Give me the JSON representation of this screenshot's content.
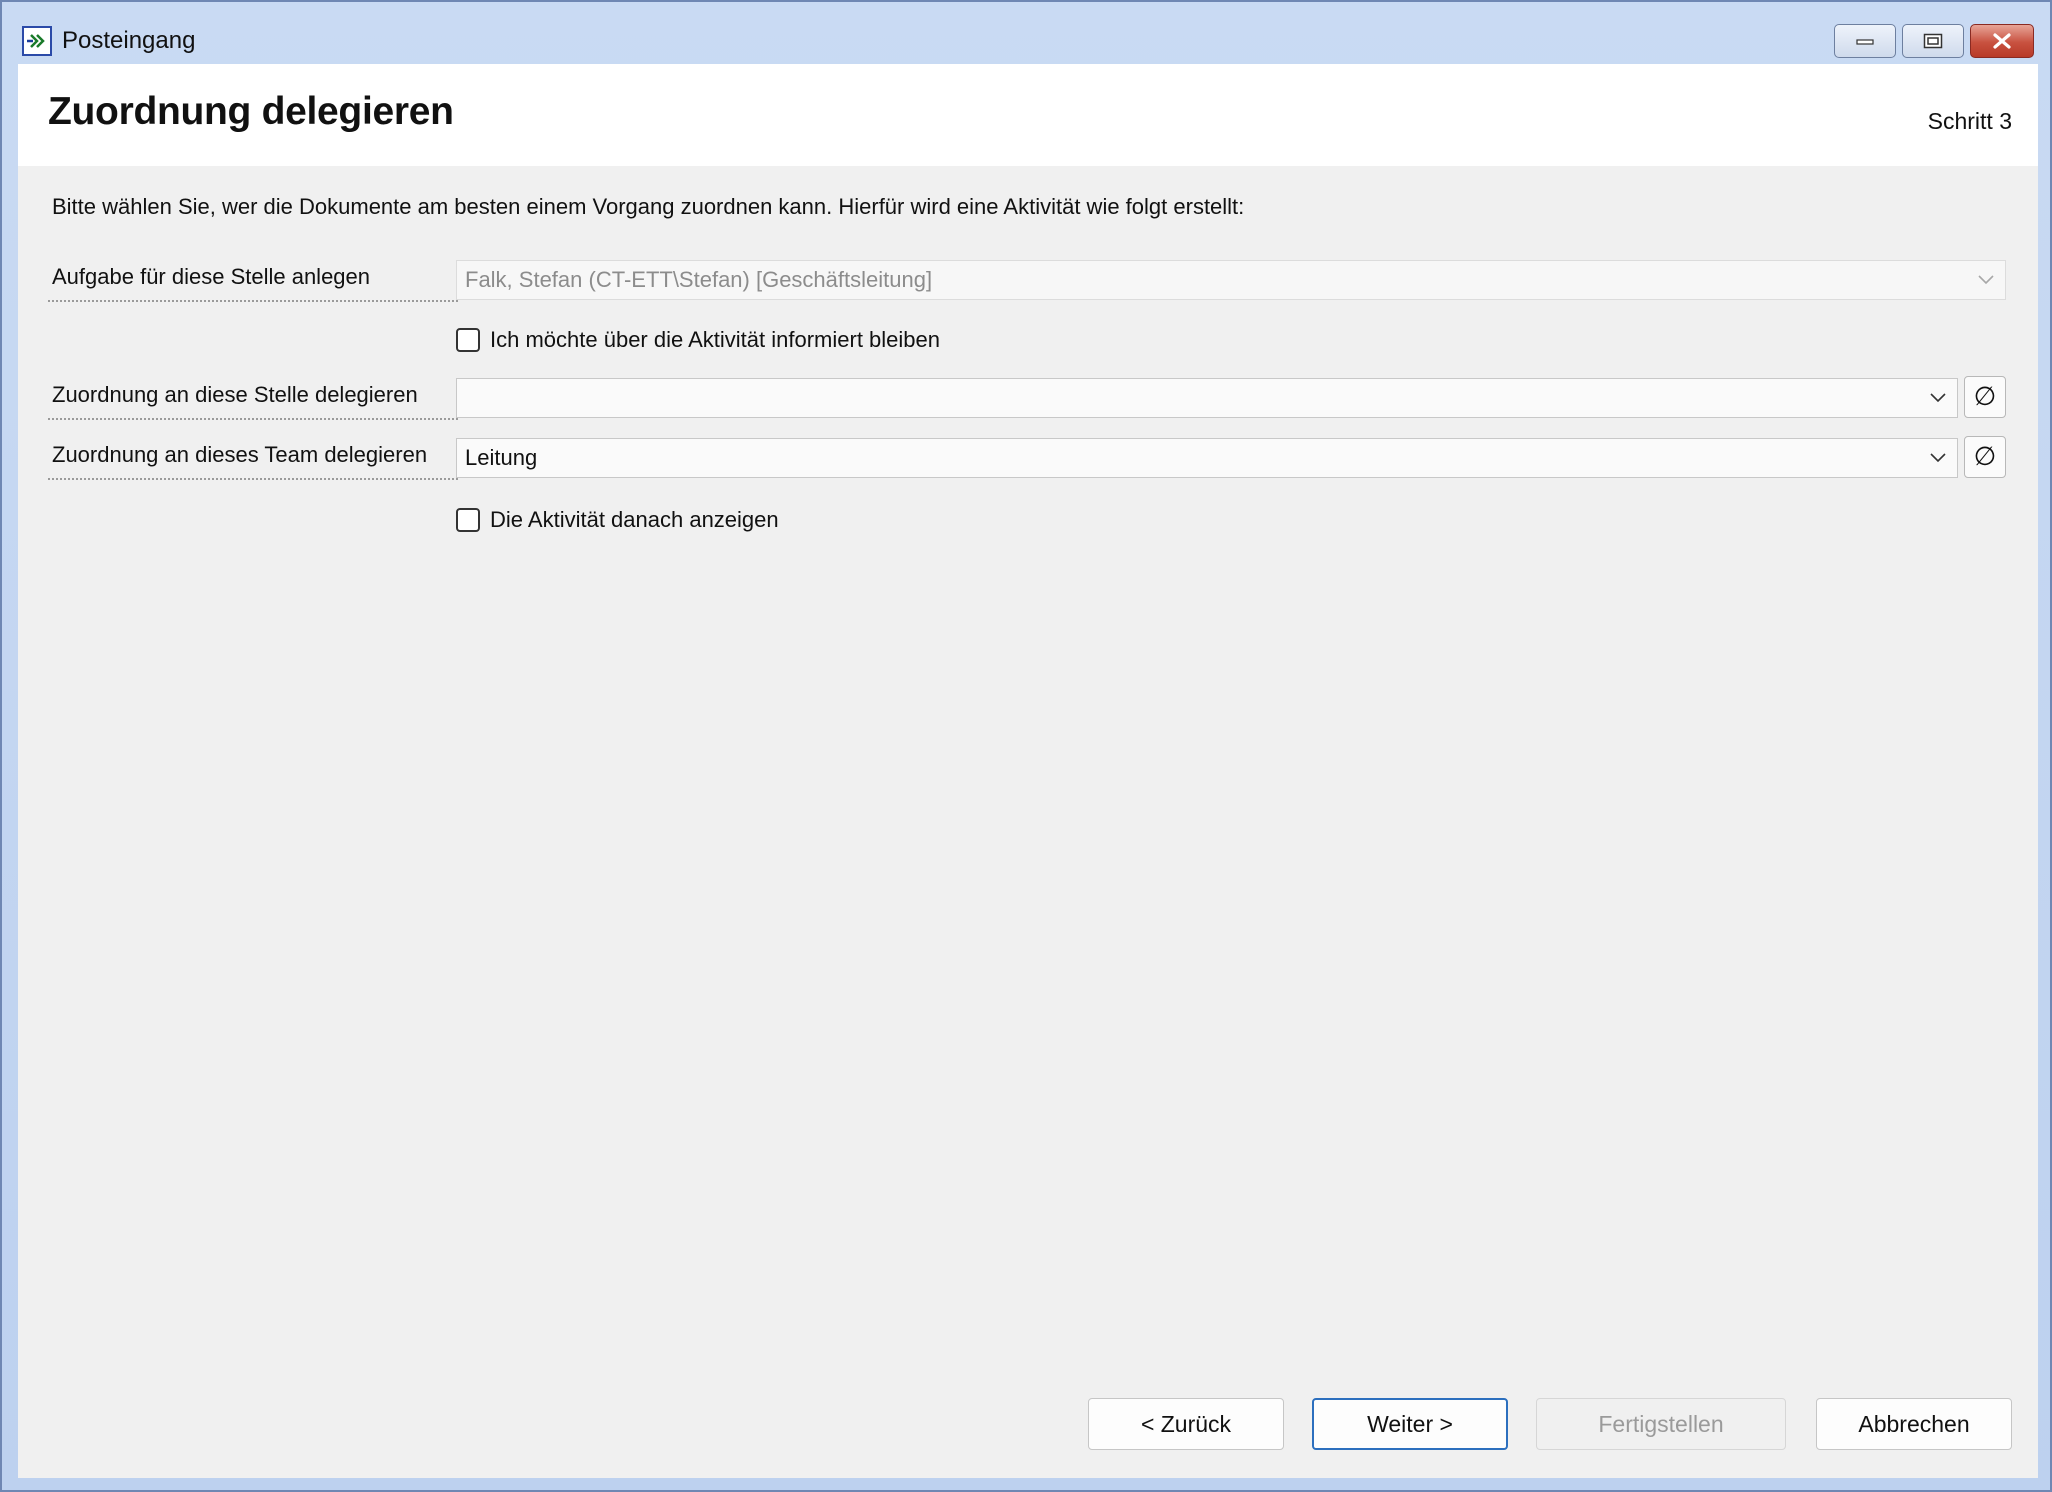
{
  "window": {
    "title": "Posteingang"
  },
  "header": {
    "title": "Zuordnung delegieren",
    "step": "Schritt 3"
  },
  "intro": "Bitte wählen Sie, wer die Dokumente am besten einem Vorgang zuordnen kann. Hierfür wird eine Aktivität wie folgt erstellt:",
  "form": {
    "task_label": "Aufgabe für diese Stelle anlegen",
    "task_value": "Falk, Stefan (CT-ETT\\Stefan) [Geschäftsleitung]",
    "inform_checkbox_label": "Ich möchte über die Aktivität informiert bleiben",
    "inform_checked": false,
    "delegate_position_label": "Zuordnung an diese Stelle delegieren",
    "delegate_position_value": "",
    "delegate_team_label": "Zuordnung an dieses Team delegieren",
    "delegate_team_value": "Leitung",
    "clear_symbol": "∅",
    "show_activity_label": "Die Aktivität danach anzeigen",
    "show_activity_checked": false
  },
  "buttons": {
    "back": "< Zurück",
    "next": "Weiter >",
    "finish": "Fertigstellen",
    "cancel": "Abbrechen"
  },
  "colors": {
    "accent": "#2c6fbe",
    "close_button": "#c8513f",
    "titlebar": "#c9daf3"
  }
}
